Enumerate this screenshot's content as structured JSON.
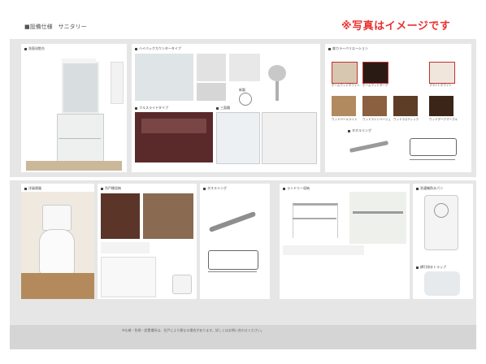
{
  "header": {
    "title": "■設備仕様　サニタリー",
    "notice": "※写真はイメージです",
    "accent_color": "#e8322f"
  },
  "sections": {
    "vanity": {
      "label": "洗面化粧台"
    },
    "counter": {
      "label": "ハイバックカウンタータイプ"
    },
    "faucet_note": {
      "label": "新製"
    },
    "storage": {
      "label": "フルスライドタイプ"
    },
    "mirror_cabinet": {
      "label": "三面鏡"
    },
    "color_variation": {
      "label": "扉カラーバリエーション"
    },
    "colors_top": [
      "ホームウッドホワイト",
      "ホームウッドダーク",
      "ブライトホワイト"
    ],
    "colors_bottom": [
      "ウッドベールライト",
      "ウッドライトベージュ",
      "ウッドラスティック",
      "ウッドダークマーブル"
    ],
    "towel_ring_top": {
      "label": "タオルリング"
    },
    "toilet": {
      "label": "洋風便器"
    },
    "toilet_storage": {
      "label": "吊戸棚収納"
    },
    "towel_ring_lower": {
      "label": "タオルリング"
    },
    "laundry": {
      "label": "ランドリー収納"
    },
    "washer_pan": {
      "label": "洗濯機防水パン"
    },
    "drain": {
      "label": "横引排水トラップ"
    },
    "control_panel": {
      "label": "便座コントローラー"
    }
  },
  "footer": {
    "note": "※仕様・色柄・設置場所は、住戸により異なる場合があります。詳しくはお問い合わせください。"
  }
}
